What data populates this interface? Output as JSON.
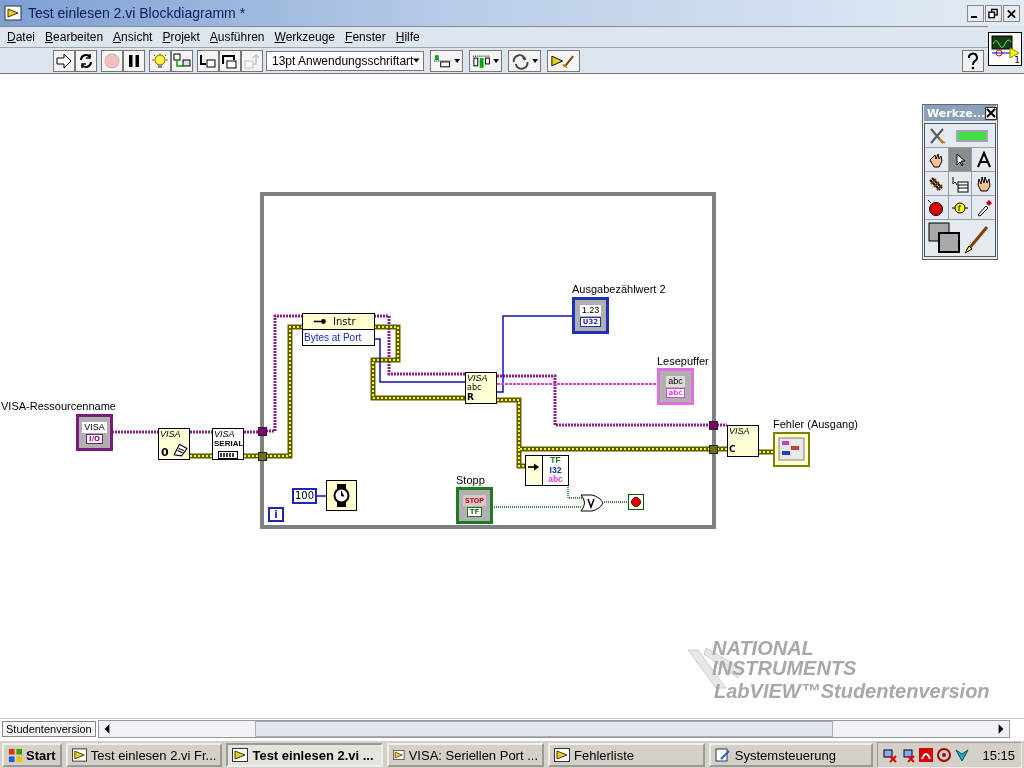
{
  "window": {
    "title": "Test einlesen 2.vi Blockdiagramm *"
  },
  "menu": [
    {
      "label": "Datei"
    },
    {
      "label": "Bearbeiten"
    },
    {
      "label": "Ansicht"
    },
    {
      "label": "Projekt"
    },
    {
      "label": "Ausführen"
    },
    {
      "label": "Werkzeuge"
    },
    {
      "label": "Fenster"
    },
    {
      "label": "Hilfe"
    }
  ],
  "toolbar": {
    "buttons": [
      {
        "kind": "run",
        "disabled": false
      },
      {
        "kind": "run-continuously",
        "disabled": false
      },
      {
        "kind": "abort",
        "disabled": true
      },
      {
        "kind": "pause",
        "disabled": false
      },
      {
        "kind": "highlight",
        "disabled": false
      },
      {
        "kind": "retain",
        "disabled": false
      },
      {
        "kind": "step-into",
        "disabled": false
      },
      {
        "kind": "step-over",
        "disabled": false
      },
      {
        "kind": "step-out",
        "disabled": true
      }
    ],
    "font": "13pt Anwendungsschriftart",
    "arrange": [
      {
        "kind": "align"
      },
      {
        "kind": "distribute"
      },
      {
        "kind": "reorder"
      },
      {
        "kind": "cleanup"
      }
    ]
  },
  "connector_pane": {
    "label": "1"
  },
  "tools_palette": {
    "title": "Werkze...",
    "tools": [
      {
        "kind": "auto",
        "selected": false
      },
      {
        "kind": "operate",
        "selected": false
      },
      {
        "kind": "position",
        "selected": true
      },
      {
        "kind": "text",
        "selected": false
      },
      {
        "kind": "wire",
        "selected": false
      },
      {
        "kind": "shortcut",
        "selected": false
      },
      {
        "kind": "scroll",
        "selected": false
      },
      {
        "kind": "breakpoint",
        "selected": false
      },
      {
        "kind": "probe",
        "selected": false
      },
      {
        "kind": "color-copy",
        "selected": false
      },
      {
        "kind": "color",
        "selected": false
      }
    ]
  },
  "diagram": {
    "resource_control": {
      "label": "VISA-Ressourcenname",
      "value": "VISA",
      "type": "I/O"
    },
    "configure_node": {
      "title": "VISA",
      "digit": "0"
    },
    "serial_node": {
      "title": "VISA",
      "subtitle": "SERIAL"
    },
    "property_node": {
      "class": "Instr",
      "property": "Bytes at Port"
    },
    "count_indicator": {
      "label": "Ausgabezählwert 2",
      "value": "1.23",
      "type": "U32"
    },
    "read_node": {
      "title": "VISA",
      "text": "abc",
      "mode": "R"
    },
    "buffer_indicator": {
      "label": "Lesepuffer",
      "value": "abc",
      "type": "abc"
    },
    "close_node": {
      "title": "VISA",
      "mode": "C"
    },
    "error_indicator": {
      "label": "Fehler (Ausgang)"
    },
    "wait_constant": {
      "value": "100"
    },
    "iteration_terminal": {
      "label": "i"
    },
    "stop_control": {
      "label": "Stopp",
      "value": "STOP",
      "type": "TF"
    },
    "status_node": {
      "types": [
        "TF",
        "I32",
        "abc"
      ]
    }
  },
  "watermark": {
    "lines": [
      "NATIONAL",
      "INSTRUMENTS"
    ],
    "product": "LabVIEW™Studentenversion"
  },
  "scroll_label": "Studentenversion",
  "taskbar": {
    "start": "Start",
    "tasks": [
      {
        "kind": "labview",
        "label": "Test einlesen 2.vi Fr...",
        "selected": false
      },
      {
        "kind": "labview",
        "label": "Test einlesen 2.vi ...",
        "selected": true
      },
      {
        "kind": "labview",
        "label": "VISA: Seriellen Port ...",
        "selected": false
      },
      {
        "kind": "labview",
        "label": "Fehlerliste",
        "selected": false
      },
      {
        "kind": "control-panel",
        "label": "Systemsteuerung",
        "selected": false
      }
    ],
    "clock": "15:15"
  }
}
